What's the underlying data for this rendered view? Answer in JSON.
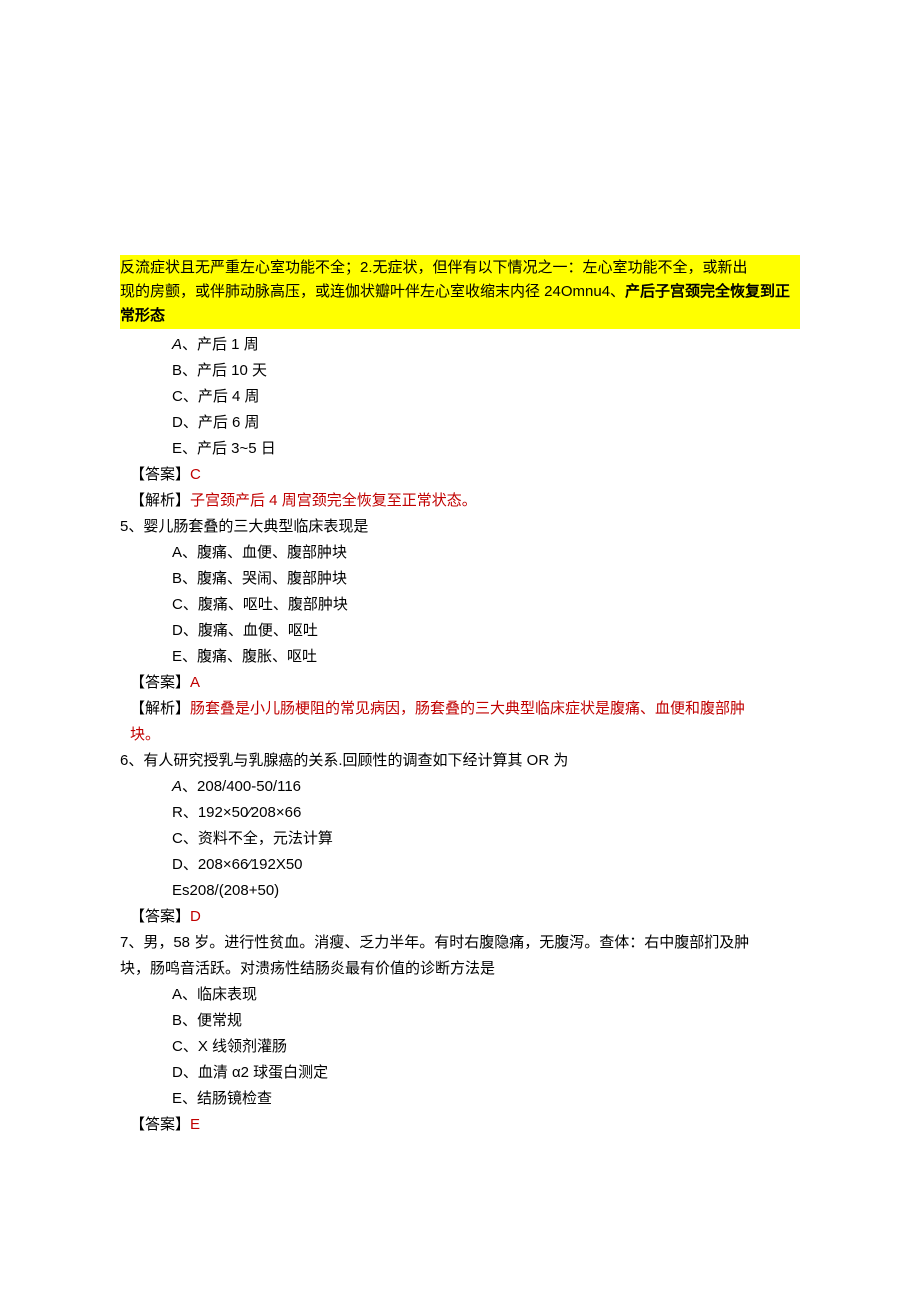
{
  "highlight": {
    "line1": "反流症状且无严重左心室功能不全；2.无症状，但伴有以下情况之一：左心室功能不全，或新出",
    "line2_plain": "现的房颤，或伴肺动脉高压，或连伽状瓣叶伴左心室收缩末内径 24Omnu4、",
    "line2_bold": "产后子宫颈完全恢复到正常形态"
  },
  "q4": {
    "optA_label": "A",
    "optA_text": "、产后 1 周",
    "optB": "B、产后 10 天",
    "optC": "C、产后 4 周",
    "optD": "D、产后 6 周",
    "optE": "E、产后 3~5 日",
    "ans_bracket": "【答案】",
    "ans_letter": "C",
    "expl_bracket": "【解析】",
    "expl_text": "子宫颈产后 4 周宫颈完全恢复至正常状态。"
  },
  "q5": {
    "question": "5、婴儿肠套叠的三大典型临床表现是",
    "optA": "A、腹痛、血便、腹部肿块",
    "optB": "B、腹痛、哭闹、腹部肿块",
    "optC": "C、腹痛、呕吐、腹部肿块",
    "optD": "D、腹痛、血便、呕吐",
    "optE": "E、腹痛、腹胀、呕吐",
    "ans_bracket": "【答案】",
    "ans_letter": "A",
    "expl_bracket": "【解析】",
    "expl_text1": "肠套叠是小儿肠梗阻的常见病因，肠套叠的三大典型临床症状是腹痛、血便和腹部肿",
    "expl_text2": "块。"
  },
  "q6": {
    "question": "6、有人研究授乳与乳腺癌的关系.回顾性的调查如下经计算其 OR 为",
    "optA_label": "A",
    "optA_text": "、208/400-50/116",
    "optB": "R、192×50⁄208×66",
    "optC": "C、资料不全，元法计算",
    "optD": "D、208×66⁄192X50",
    "optE": "Es208/(208+50)",
    "ans_bracket": "【答案】",
    "ans_letter": "D"
  },
  "q7": {
    "question1": "7、男，58 岁。进行性贫血。消瘦、乏力半年。有时右腹隐痛，无腹泻。查体：右中腹部扪及肿",
    "question2": "块，肠鸣音活跃。对溃疡性结肠炎最有价值的诊断方法是",
    "optA": "A、临床表现",
    "optB": "B、便常规",
    "optC": "C、X 线领剂灌肠",
    "optD": "D、血清 α2 球蛋白测定",
    "optE": "E、结肠镜检查",
    "ans_bracket": "【答案】",
    "ans_letter": "E"
  }
}
